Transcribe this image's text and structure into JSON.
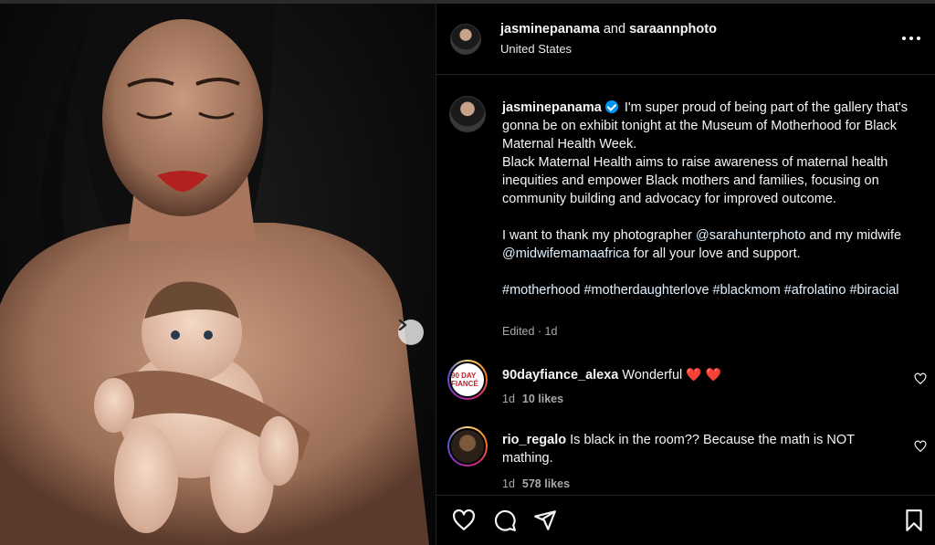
{
  "post": {
    "header": {
      "user1": "jasminepanama",
      "and_text": "and",
      "user2": "saraannphoto",
      "location": "United States"
    },
    "caption": {
      "username": "jasminepanama",
      "line1": "I'm super proud of being part of the gallery that's gonna be on exhibit tonight at the Museum of Motherhood for Black Maternal Health Week.",
      "line2": "Black Maternal Health aims to raise awareness of maternal health inequities and empower Black mothers and families, focusing on community building and advocacy for improved outcome.",
      "thanks_prefix": "I want to thank my photographer",
      "photographer": "@sarahunterphoto",
      "thanks_mid": "and my midwife",
      "midwife": "@midwifemamaafrica",
      "thanks_suffix": "for all your love and support.",
      "hashtags": "#motherhood #motherdaughterlove #blackmom #afrolatino #biracial",
      "edited": "Edited · 1d"
    },
    "comments": [
      {
        "username": "90dayfiance_alexa",
        "text": "Wonderful",
        "hearts": "❤️ ❤️",
        "avatar_label": "90 DAY FIANCÉ",
        "age": "1d",
        "likes": "10 likes"
      },
      {
        "username": "rio_regalo",
        "text": "Is black in the room?? Because the math is NOT mathing.",
        "age": "1d",
        "likes": "578 likes"
      }
    ],
    "actions": [
      "heart-icon",
      "comment-icon",
      "share-icon",
      "bookmark-icon"
    ]
  }
}
